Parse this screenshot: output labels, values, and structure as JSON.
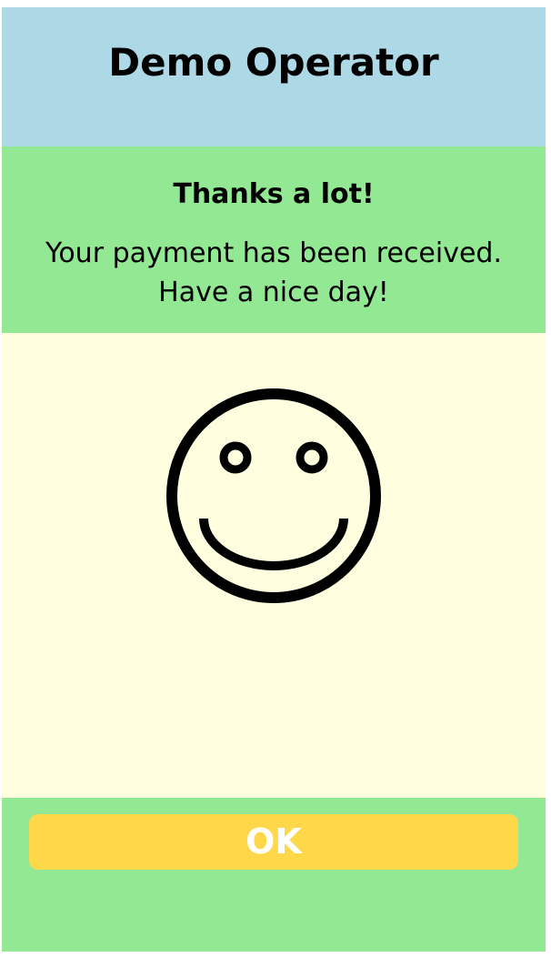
{
  "header": {
    "operator_name": "Demo Operator",
    "background_color": "#add8e6"
  },
  "message": {
    "title": "Thanks a lot!",
    "line1": "Your payment has been received.",
    "line2": "Have a nice day!",
    "background_color": "#93e993"
  },
  "content": {
    "icon": "smiley-face-icon",
    "background_color": "#ffffe0"
  },
  "footer": {
    "ok_label": "OK",
    "button_color": "#ffd84a",
    "background_color": "#93e993"
  }
}
